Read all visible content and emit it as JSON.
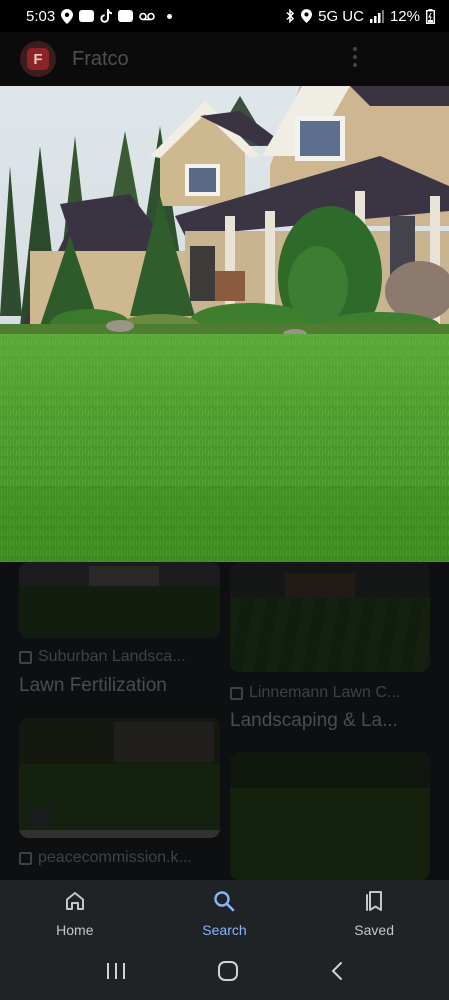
{
  "status_bar": {
    "time": "5:03",
    "network": "5G UC",
    "battery": "12%"
  },
  "app_bar": {
    "logo_letter": "F",
    "title": "Fratco"
  },
  "results": [
    {
      "source": "Suburban Landsca...",
      "title": "Lawn Fertilization"
    },
    {
      "source": "Linnemann Lawn C...",
      "title": "Landscaping & La..."
    },
    {
      "source": "peacecommission.k...",
      "title": ""
    }
  ],
  "bottom_nav": {
    "home_label": "Home",
    "search_label": "Search",
    "saved_label": "Saved"
  },
  "colors": {
    "accent": "#8ab4f8",
    "nav_background": "#1f2326"
  }
}
